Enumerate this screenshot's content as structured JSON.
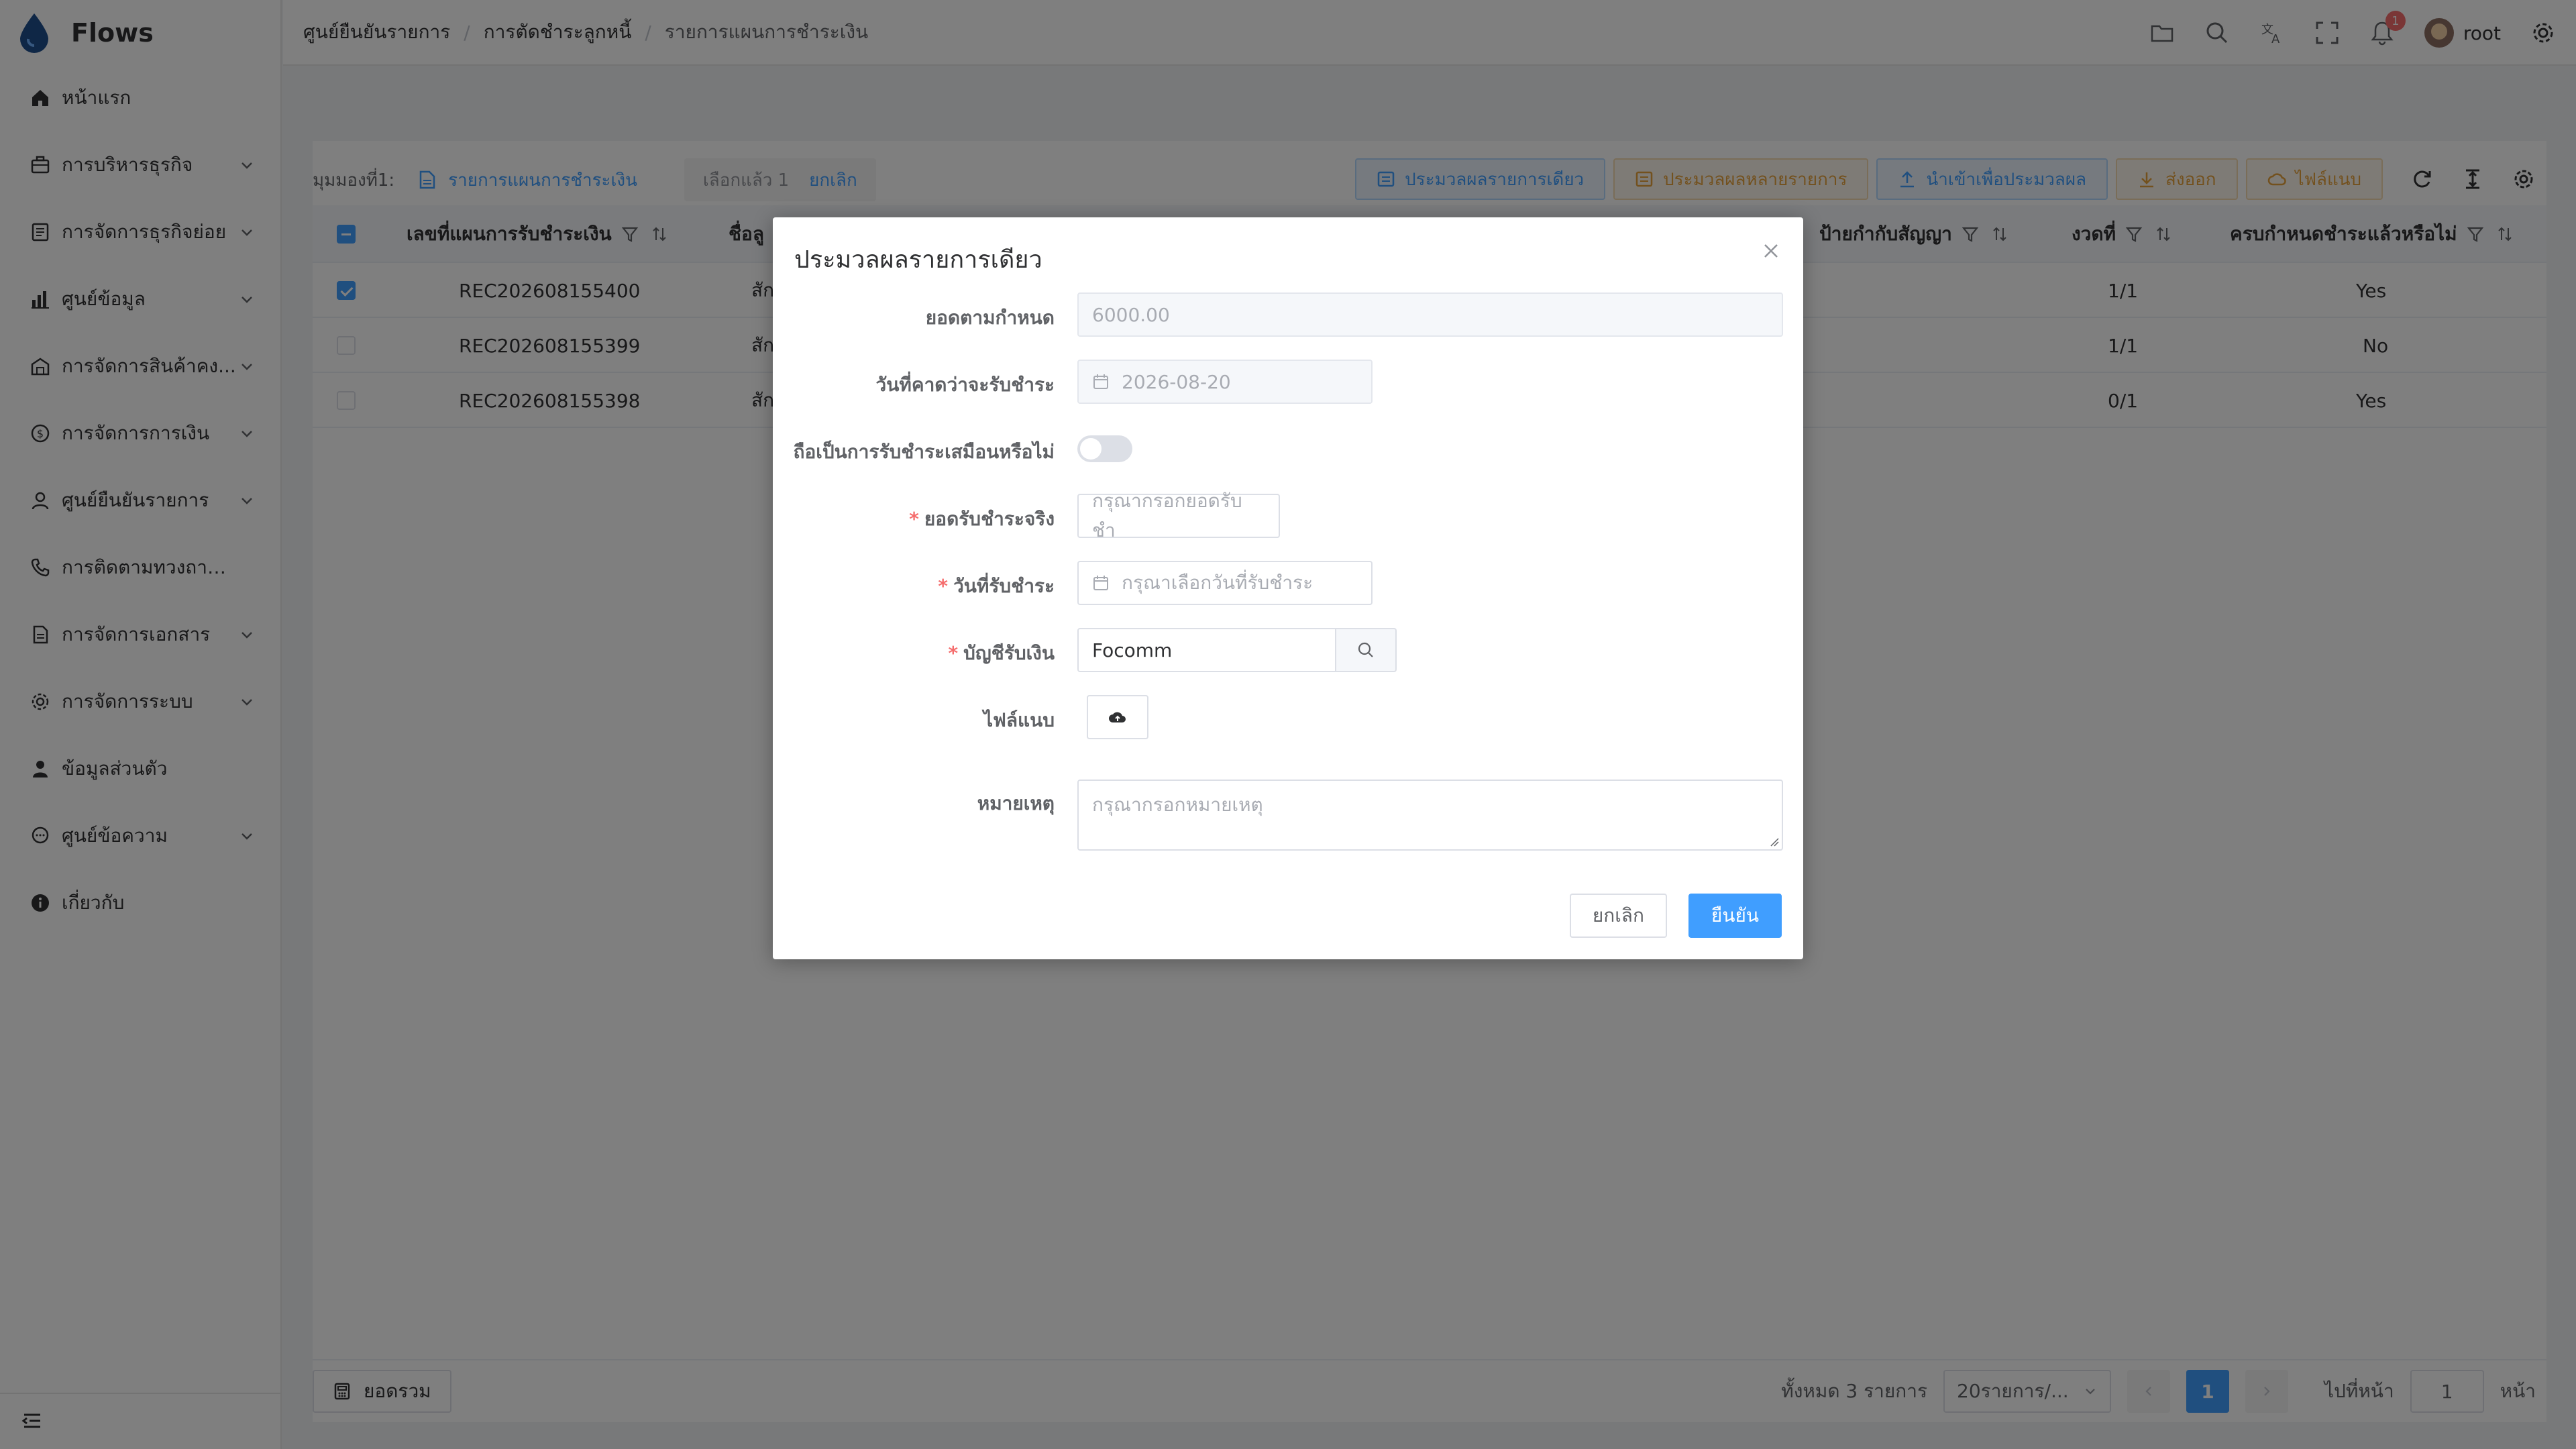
{
  "app": {
    "name": "Flows"
  },
  "sidebar": {
    "items": [
      {
        "label": "หน้าแรก",
        "icon": "home-icon"
      },
      {
        "label": "การบริหารธุรกิจ",
        "icon": "briefcase-icon"
      },
      {
        "label": "การจัดการธุรกิจย่อย",
        "icon": "document-list-icon"
      },
      {
        "label": "ศูนย์ข้อมูล",
        "icon": "bar-chart-icon"
      },
      {
        "label": "การจัดการสินค้าคง...",
        "icon": "warehouse-icon"
      },
      {
        "label": "การจัดการการเงิน",
        "icon": "money-icon"
      },
      {
        "label": "ศูนย์ยืนยันรายการ",
        "icon": "user-check-icon"
      },
      {
        "label": "การติดตามทวงถามหนี้",
        "icon": "phone-icon"
      },
      {
        "label": "การจัดการเอกสาร",
        "icon": "file-icon"
      },
      {
        "label": "การจัดการระบบ",
        "icon": "gear-icon"
      },
      {
        "label": "ข้อมูลส่วนตัว",
        "icon": "person-icon"
      },
      {
        "label": "ศูนย์ข้อความ",
        "icon": "message-icon"
      },
      {
        "label": "เกี่ยวกับ",
        "icon": "info-icon"
      }
    ]
  },
  "header": {
    "breadcrumb": [
      "ศูนย์ยืนยันรายการ",
      "การตัดชำระลูกหนี้",
      "รายการแผนการชำระเงิน"
    ],
    "notifications": "1",
    "user": "root"
  },
  "toolbar": {
    "view_label": "มุมมองที่1:",
    "view_link": "รายการแผนการชำระเงิน",
    "selected_text": "เลือกแล้ว 1",
    "deselect": "ยกเลิก",
    "buttons": [
      "ประมวลผลรายการเดียว",
      "ประมวลผลหลายรายการ",
      "นำเข้าเพื่อประมวลผล",
      "ส่งออก",
      "ไฟล์แนบ"
    ]
  },
  "table": {
    "columns": [
      "เลขที่แผนการรับชำระเงิน",
      "ชื่อลู",
      "ป้ายกำกับสัญญา",
      "งวดที่",
      "ครบกำหนดชำระแล้วหรือไม่"
    ],
    "rows": [
      {
        "id": "REC202608155400",
        "name": "สัก",
        "period": "1/1",
        "due": "Yes",
        "checked": true
      },
      {
        "id": "REC202608155399",
        "name": "สัก",
        "period": "1/1",
        "due": "No",
        "checked": false
      },
      {
        "id": "REC202608155398",
        "name": "สัก",
        "period": "0/1",
        "due": "Yes",
        "checked": false
      }
    ]
  },
  "footer": {
    "summary_button": "ยอดรวม",
    "total_text": "ทั้งหมด 3 รายการ",
    "page_size": "20รายการ/...",
    "current_page": "1",
    "goto_label": "ไปที่หน้า",
    "goto_value": "1",
    "page_unit": "หน้า"
  },
  "dialog": {
    "title": "ประมวลผลรายการเดียว",
    "fields": {
      "scheduled_amount": {
        "label": "ยอดตามกำหนด",
        "value": "6000.00"
      },
      "expected_date": {
        "label": "วันที่คาดว่าจะรับชำระ",
        "value": "2026-08-20"
      },
      "treat_as_paid": {
        "label": "ถือเป็นการรับชำระเสมือนหรือไม่"
      },
      "actual_amount": {
        "label": "ยอดรับชำระจริง",
        "placeholder": "กรุณากรอกยอดรับชำ"
      },
      "receive_date": {
        "label": "วันที่รับชำระ",
        "placeholder": "กรุณาเลือกวันที่รับชำระ"
      },
      "account": {
        "label": "บัญชีรับเงิน",
        "value": "Focomm"
      },
      "attachment": {
        "label": "ไฟล์แนบ"
      },
      "remark": {
        "label": "หมายเหตุ",
        "placeholder": "กรุณากรอกหมายเหตุ"
      }
    },
    "cancel_label": "ยกเลิก",
    "confirm_label": "ยืนยัน"
  },
  "colors": {
    "primary": "#409eff",
    "warning": "#e6a23c",
    "danger": "#f56c6c"
  }
}
